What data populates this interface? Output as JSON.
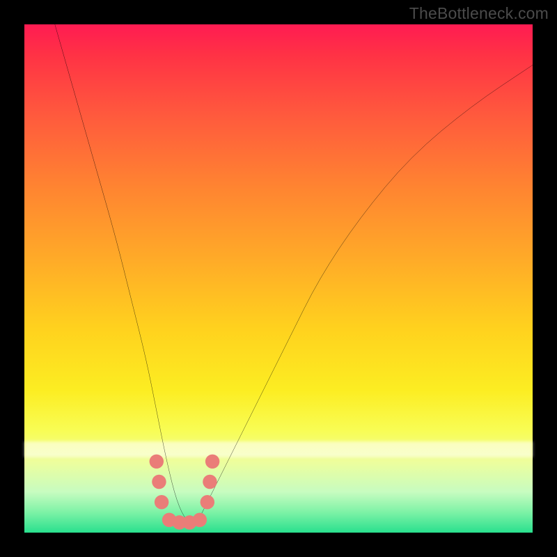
{
  "watermark": "TheBottleneck.com",
  "chart_data": {
    "type": "line",
    "title": "",
    "xlabel": "",
    "ylabel": "",
    "xlim": [
      0,
      100
    ],
    "ylim": [
      0,
      100
    ],
    "grid": false,
    "legend": false,
    "series": [
      {
        "name": "curve",
        "x": [
          6,
          10,
          14,
          18,
          21,
          24,
          26,
          28,
          30,
          32,
          34,
          36,
          40,
          46,
          52,
          58,
          66,
          76,
          88,
          100
        ],
        "y": [
          100,
          86,
          72,
          58,
          46,
          34,
          24,
          14,
          6,
          2,
          2,
          6,
          14,
          26,
          38,
          50,
          62,
          74,
          84,
          92
        ]
      }
    ],
    "markers": {
      "name": "dots",
      "color": "#ea7d78",
      "points": [
        {
          "x": 26.0,
          "y": 14
        },
        {
          "x": 26.5,
          "y": 10
        },
        {
          "x": 27.0,
          "y": 6
        },
        {
          "x": 28.5,
          "y": 2.5
        },
        {
          "x": 30.5,
          "y": 2.0
        },
        {
          "x": 32.5,
          "y": 2.0
        },
        {
          "x": 34.5,
          "y": 2.5
        },
        {
          "x": 36.0,
          "y": 6
        },
        {
          "x": 36.5,
          "y": 10
        },
        {
          "x": 37.0,
          "y": 14
        }
      ]
    },
    "background_gradient": {
      "top": "#ff1b52",
      "mid": "#ffd21e",
      "bottom": "#29e08e"
    }
  }
}
